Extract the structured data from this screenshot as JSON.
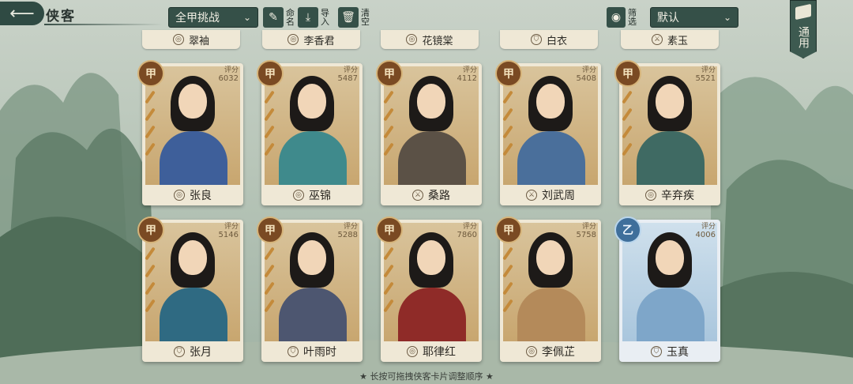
{
  "header": {
    "back_icon": "back-arrow-icon",
    "title": "侠客",
    "filter_selected": "全甲挑战",
    "tools": [
      {
        "name": "rename",
        "label": "命名",
        "icon": "brush-icon"
      },
      {
        "name": "import",
        "label": "导入",
        "icon": "download-icon"
      },
      {
        "name": "clear",
        "label": "清空",
        "icon": "trash-icon"
      },
      {
        "name": "filter",
        "label": "筛选",
        "icon": "eye-icon"
      }
    ],
    "sort_selected": "默认",
    "common_tab": "通用"
  },
  "partial_cards": [
    {
      "name": "翠袖"
    },
    {
      "name": "李香君"
    },
    {
      "name": "花镜棠"
    },
    {
      "name": "白衣"
    },
    {
      "name": "素玉"
    }
  ],
  "cards": [
    {
      "grade": "甲",
      "score_label": "评分",
      "score": "6032",
      "name": "张良",
      "faction": "swirl",
      "color": "#3e5f9a"
    },
    {
      "grade": "甲",
      "score_label": "评分",
      "score": "5487",
      "name": "巫锦",
      "faction": "swirl",
      "color": "#3f8a8c"
    },
    {
      "grade": "甲",
      "score_label": "评分",
      "score": "4112",
      "name": "桑路",
      "faction": "sword",
      "color": "#5b5146"
    },
    {
      "grade": "甲",
      "score_label": "评分",
      "score": "5408",
      "name": "刘武周",
      "faction": "sword",
      "color": "#4a6f9b"
    },
    {
      "grade": "甲",
      "score_label": "评分",
      "score": "5521",
      "name": "辛弃疾",
      "faction": "swirl",
      "color": "#3f6a63"
    },
    {
      "grade": "甲",
      "score_label": "评分",
      "score": "5146",
      "name": "张月",
      "faction": "shield",
      "color": "#2f6a82"
    },
    {
      "grade": "甲",
      "score_label": "评分",
      "score": "5288",
      "name": "叶雨时",
      "faction": "shield",
      "color": "#4d5670"
    },
    {
      "grade": "甲",
      "score_label": "评分",
      "score": "7860",
      "name": "耶律红",
      "faction": "swirl",
      "color": "#8f2b28"
    },
    {
      "grade": "甲",
      "score_label": "评分",
      "score": "5758",
      "name": "李佩芷",
      "faction": "swirl",
      "color": "#b48a5a"
    },
    {
      "grade": "乙",
      "score_label": "评分",
      "score": "4006",
      "name": "玉真",
      "faction": "shield",
      "color": "#7ea6c9"
    }
  ],
  "footer_tip": "★ 长按可拖拽侠客卡片调整顺序 ★"
}
